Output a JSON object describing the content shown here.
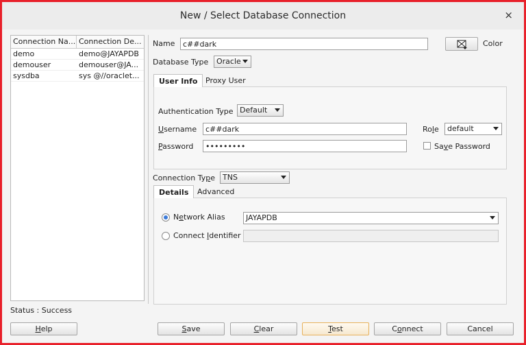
{
  "window": {
    "title": "New / Select Database Connection",
    "close_glyph": "×"
  },
  "connections": {
    "columns": [
      "Connection Na...",
      "Connection De..."
    ],
    "rows": [
      [
        "demo",
        "demo@JAYAPDB"
      ],
      [
        "demouser",
        "demouser@JA..."
      ],
      [
        "sysdba",
        "sys @//oraclet..."
      ]
    ]
  },
  "status": "Status : Success",
  "form": {
    "name_label": "Name",
    "name_value": "c##dark",
    "color_label": "Color",
    "db_type_label": "Database Type",
    "db_type_value": "Oracle",
    "tabs": [
      "User Info",
      "Proxy User"
    ],
    "auth_type_label": "Authentication Type",
    "auth_type_value": "Default",
    "username_label_u": "U",
    "username_label_rest": "sername",
    "username_value": "c##dark",
    "password_label_u": "P",
    "password_label_rest": "assword",
    "password_value": "•••••••••",
    "role_label_pre": "Ro",
    "role_label_u": "l",
    "role_label_post": "e",
    "role_value": "default",
    "save_pw_pre": "Sa",
    "save_pw_u": "v",
    "save_pw_post": "e Password",
    "conn_type_label_pre": "Connection Ty",
    "conn_type_label_u": "p",
    "conn_type_label_post": "e",
    "conn_type_value": "TNS",
    "sub_tabs": [
      "Details",
      "Advanced"
    ],
    "network_alias_pre": "N",
    "network_alias_u": "e",
    "network_alias_post": "twork Alias",
    "network_alias_value": "JAYAPDB",
    "connect_id_pre": "Connect ",
    "connect_id_u": "I",
    "connect_id_post": "dentifier"
  },
  "buttons": {
    "help_u": "H",
    "help_rest": "elp",
    "save_u": "S",
    "save_rest": "ave",
    "clear_u": "C",
    "clear_rest": "lear",
    "test_u": "T",
    "test_rest": "est",
    "connect_pre": "C",
    "connect_u": "o",
    "connect_post": "nnect",
    "cancel": "Cancel"
  },
  "colors": {
    "highlight_border": "#e8202a",
    "focus_button": "#e7b15a",
    "radio_dot": "#3b7ad8"
  },
  "icons": {
    "color_button": "color-picker-icon",
    "close": "close-icon",
    "dropdown": "chevron-down-icon"
  }
}
